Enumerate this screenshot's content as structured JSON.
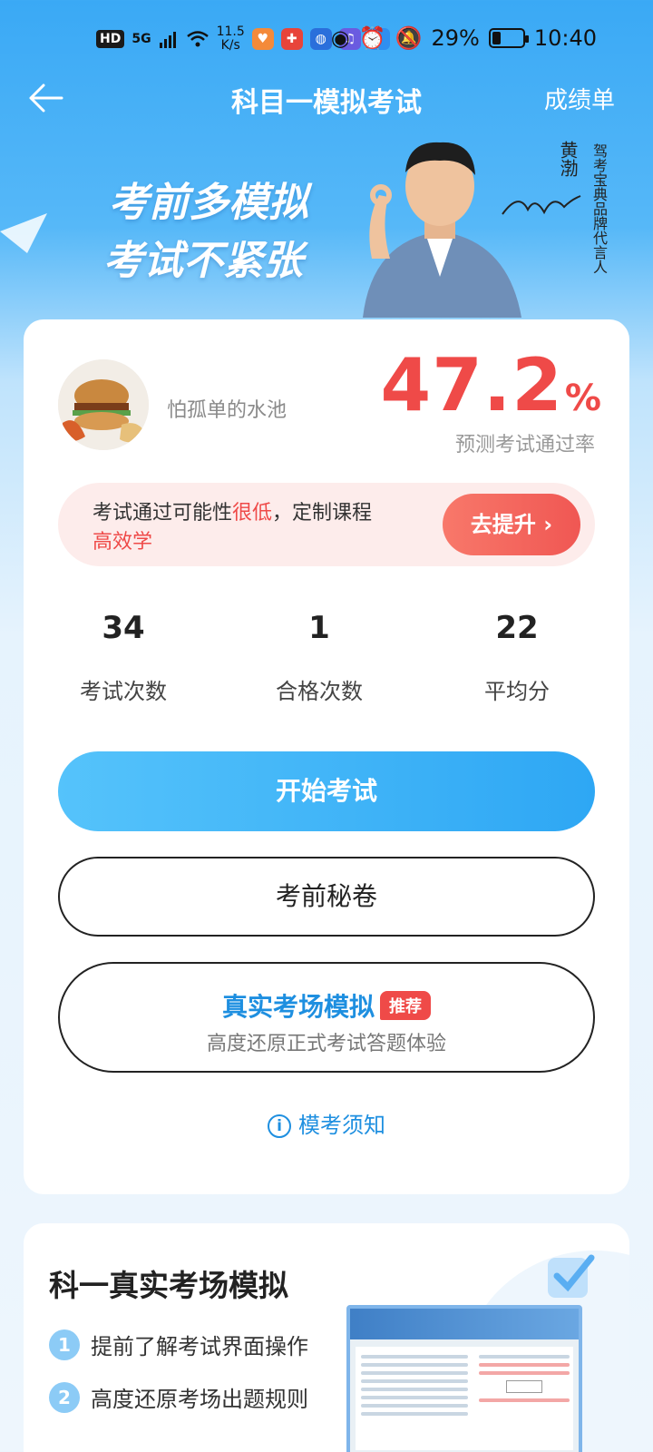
{
  "status_bar": {
    "hd_badge": "HD",
    "signal_label": "5G",
    "net_speed_value": "11.5",
    "net_speed_unit": "K/s",
    "battery_percent": "29%",
    "battery_level": 0.29,
    "time": "10:40",
    "icons": [
      "wifi-icon",
      "app-health-icon",
      "app-pinwheel-icon",
      "app-bulb-icon",
      "app-music-icon",
      "app-search-icon",
      "eye-icon",
      "alarm-icon",
      "mute-icon"
    ]
  },
  "header": {
    "title": "科目一模拟考试",
    "right_link": "成绩单"
  },
  "banner": {
    "slogan_line1": "考前多模拟",
    "slogan_line2": "考试不紧张",
    "spokesperson_name": "黄渤",
    "spokesperson_role": "驾考宝典品牌代言人"
  },
  "profile": {
    "username": "怕孤单的水池",
    "pass_rate_value": "47.2",
    "pass_rate_unit": "%",
    "pass_rate_label": "预测考试通过率"
  },
  "tip": {
    "text_prefix": "考试通过可能性",
    "text_highlight": "很低",
    "text_suffix": "，定制课程",
    "text_line2": "高效学",
    "button_label": "去提升"
  },
  "stats": [
    {
      "value": "34",
      "label": "考试次数"
    },
    {
      "value": "1",
      "label": "合格次数"
    },
    {
      "value": "22",
      "label": "平均分"
    }
  ],
  "actions": {
    "start_exam": "开始考试",
    "secret_paper": "考前秘卷",
    "real_sim_title": "真实考场模拟",
    "real_sim_tag": "推荐",
    "real_sim_subtitle": "高度还原正式考试答题体验",
    "notice_link": "模考须知"
  },
  "bottom_card": {
    "title": "科一真实考场模拟",
    "items": [
      {
        "num": "1",
        "text": "提前了解考试界面操作"
      },
      {
        "num": "2",
        "text": "高度还原考场出题规则"
      }
    ]
  },
  "colors": {
    "accent_blue": "#2ea7f4",
    "alert_red": "#ef4a48",
    "tip_bg": "#fdeceb"
  }
}
